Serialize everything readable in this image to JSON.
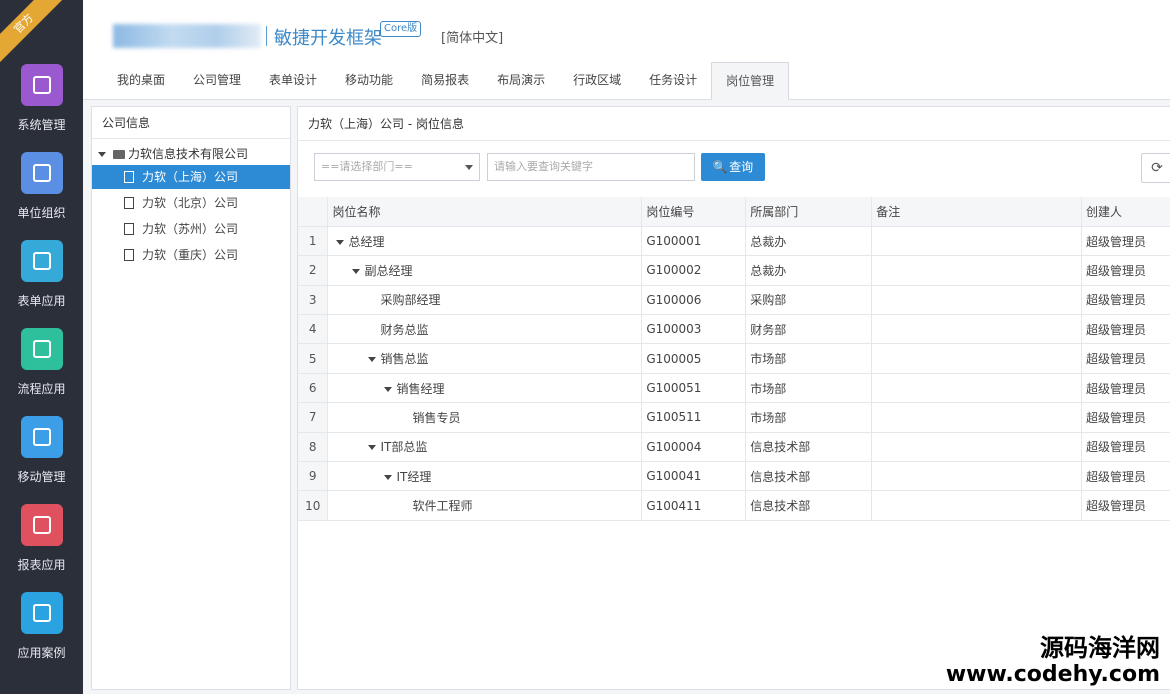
{
  "ribbon_text": "官方",
  "nav": [
    {
      "label": "系统管理",
      "icon": "monitor-icon",
      "color": "#9b59d0"
    },
    {
      "label": "单位组织",
      "icon": "cup-icon",
      "color": "#5b8fe3"
    },
    {
      "label": "表单应用",
      "icon": "grid-icon",
      "color": "#35a9d8"
    },
    {
      "label": "流程应用",
      "icon": "share-icon",
      "color": "#2ebf9c"
    },
    {
      "label": "移动管理",
      "icon": "android-icon",
      "color": "#3d9ee8"
    },
    {
      "label": "报表应用",
      "icon": "area-chart-icon",
      "color": "#e0515f"
    },
    {
      "label": "应用案例",
      "icon": "send-icon",
      "color": "#2aa3e0"
    }
  ],
  "header": {
    "product": "敏捷开发框架",
    "badge": "Core版",
    "language": "[简体中文]"
  },
  "tabs": [
    {
      "label": "我的桌面"
    },
    {
      "label": "公司管理"
    },
    {
      "label": "表单设计"
    },
    {
      "label": "移动功能"
    },
    {
      "label": "简易报表"
    },
    {
      "label": "布局演示"
    },
    {
      "label": "行政区域"
    },
    {
      "label": "任务设计"
    },
    {
      "label": "岗位管理",
      "active": true
    }
  ],
  "tree": {
    "title": "公司信息",
    "root": "力软信息技术有限公司",
    "nodes": [
      {
        "label": "力软（上海）公司",
        "selected": true
      },
      {
        "label": "力软（北京）公司"
      },
      {
        "label": "力软（苏州）公司"
      },
      {
        "label": "力软（重庆）公司"
      }
    ]
  },
  "content": {
    "title": "力软（上海）公司 - 岗位信息",
    "dept_select": "==请选择部门==",
    "search_placeholder": "请输入要查询关键字",
    "query_label": "查询",
    "refresh_glyph": "⟳"
  },
  "table": {
    "columns": [
      "岗位名称",
      "岗位编号",
      "所属部门",
      "备注",
      "创建人"
    ],
    "rows": [
      {
        "no": "1",
        "name": "总经理",
        "level": 0,
        "expand": true,
        "code": "G100001",
        "dept": "总裁办",
        "note": "",
        "creator": "超级管理员"
      },
      {
        "no": "2",
        "name": "副总经理",
        "level": 1,
        "expand": true,
        "code": "G100002",
        "dept": "总裁办",
        "note": "",
        "creator": "超级管理员"
      },
      {
        "no": "3",
        "name": "采购部经理",
        "level": 2,
        "expand": false,
        "code": "G100006",
        "dept": "采购部",
        "note": "",
        "creator": "超级管理员"
      },
      {
        "no": "4",
        "name": "财务总监",
        "level": 2,
        "expand": false,
        "code": "G100003",
        "dept": "财务部",
        "note": "",
        "creator": "超级管理员"
      },
      {
        "no": "5",
        "name": "销售总监",
        "level": 2,
        "expand": true,
        "code": "G100005",
        "dept": "市场部",
        "note": "",
        "creator": "超级管理员"
      },
      {
        "no": "6",
        "name": "销售经理",
        "level": 3,
        "expand": true,
        "code": "G100051",
        "dept": "市场部",
        "note": "",
        "creator": "超级管理员"
      },
      {
        "no": "7",
        "name": "销售专员",
        "level": 4,
        "expand": false,
        "code": "G100511",
        "dept": "市场部",
        "note": "",
        "creator": "超级管理员"
      },
      {
        "no": "8",
        "name": "IT部总监",
        "level": 2,
        "expand": true,
        "code": "G100004",
        "dept": "信息技术部",
        "note": "",
        "creator": "超级管理员"
      },
      {
        "no": "9",
        "name": "IT经理",
        "level": 3,
        "expand": true,
        "code": "G100041",
        "dept": "信息技术部",
        "note": "",
        "creator": "超级管理员"
      },
      {
        "no": "10",
        "name": "软件工程师",
        "level": 4,
        "expand": false,
        "code": "G100411",
        "dept": "信息技术部",
        "note": "",
        "creator": "超级管理员"
      }
    ]
  },
  "watermark": {
    "line1": "源码海洋网",
    "line2": "www.codehy.com"
  }
}
